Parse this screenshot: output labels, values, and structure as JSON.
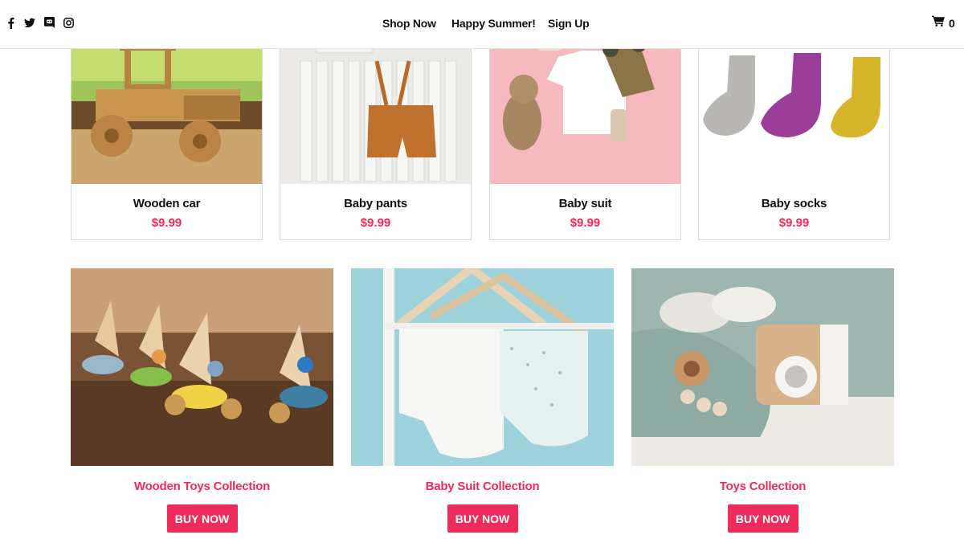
{
  "header": {
    "social_icons": [
      "facebook-icon",
      "twitter-icon",
      "discord-icon",
      "instagram-icon"
    ],
    "nav": [
      {
        "label": "Shop Now"
      },
      {
        "label": "Happy Summer!"
      },
      {
        "label": "Sign Up"
      }
    ],
    "cart": {
      "icon": "shopping-cart-icon",
      "count": "0"
    }
  },
  "products": [
    {
      "name": "Wooden car",
      "price": "$9.99"
    },
    {
      "name": "Baby pants",
      "price": "$9.99"
    },
    {
      "name": "Baby suit",
      "price": "$9.99"
    },
    {
      "name": "Baby socks",
      "price": "$9.99"
    }
  ],
  "collections": [
    {
      "title": "Wooden Toys Collection",
      "button": "BUY NOW"
    },
    {
      "title": "Baby Suit Collection",
      "button": "BUY NOW"
    },
    {
      "title": "Toys Collection",
      "button": "BUY NOW"
    }
  ],
  "colors": {
    "accent": "#ef2b5b",
    "text": "#111111",
    "border": "#d9d9d9"
  }
}
